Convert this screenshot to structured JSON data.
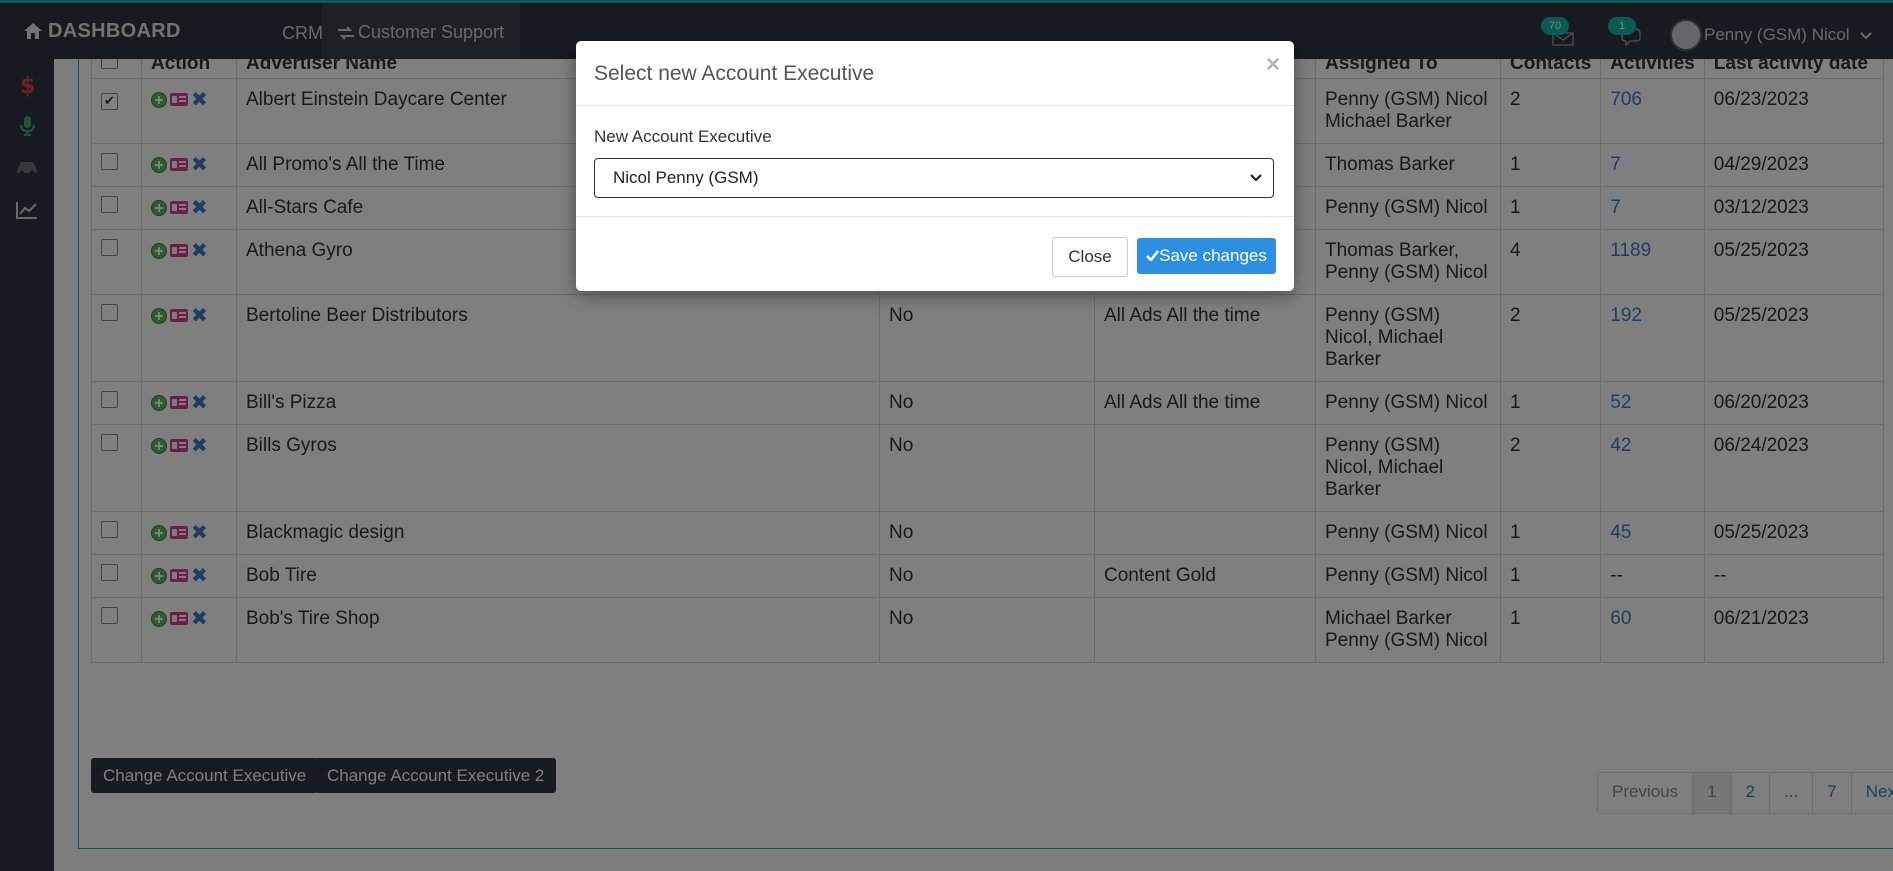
{
  "topbar": {
    "brand": "DASHBOARD",
    "nav_crm": "CRM",
    "nav_customer_support": "Customer Support",
    "notif_messages": "70",
    "notif_chat": "1",
    "user_name": "Penny (GSM) Nicol"
  },
  "sidebar": {
    "icons": [
      "dollar-icon",
      "microphone-icon",
      "car-icon",
      "line-chart-icon"
    ]
  },
  "table": {
    "headers": [
      "",
      "Action",
      "Advertiser Name",
      "",
      "",
      "Assigned To",
      "Contacts",
      "Activities",
      "Last activity date"
    ],
    "rows": [
      {
        "checked": true,
        "name": "Albert Einstein Daycare Center",
        "col4": "",
        "col5": "",
        "assigned": "Penny (GSM) Nicol Michael Barker",
        "contacts": "2",
        "activities": "706",
        "last": "06/23/2023"
      },
      {
        "checked": false,
        "name": "All Promo's All the Time",
        "col4": "",
        "col5": "",
        "assigned": "Thomas Barker",
        "contacts": "1",
        "activities": "7",
        "last": "04/29/2023"
      },
      {
        "checked": false,
        "name": "All-Stars Cafe",
        "col4": "",
        "col5": "",
        "assigned": "Penny (GSM) Nicol",
        "contacts": "1",
        "activities": "7",
        "last": "03/12/2023"
      },
      {
        "checked": false,
        "name": "Athena Gyro",
        "col4": "",
        "col5": "",
        "assigned": "Thomas Barker, Penny (GSM) Nicol",
        "contacts": "4",
        "activities": "1189",
        "last": "05/25/2023"
      },
      {
        "checked": false,
        "name": "Bertoline Beer Distributors",
        "col4": "No",
        "col5": "All Ads All the time",
        "assigned": "Penny (GSM) Nicol, Michael Barker",
        "contacts": "2",
        "activities": "192",
        "last": "05/25/2023"
      },
      {
        "checked": false,
        "name": "Bill's Pizza",
        "col4": "No",
        "col5": "All Ads All the time",
        "assigned": "Penny (GSM) Nicol",
        "contacts": "1",
        "activities": "52",
        "last": "06/20/2023"
      },
      {
        "checked": false,
        "name": "Bills Gyros",
        "col4": "No",
        "col5": "",
        "assigned": "Penny (GSM) Nicol, Michael Barker",
        "contacts": "2",
        "activities": "42",
        "last": "06/24/2023"
      },
      {
        "checked": false,
        "name": "Blackmagic design",
        "col4": "No",
        "col5": "",
        "assigned": "Penny (GSM) Nicol",
        "contacts": "1",
        "activities": "45",
        "last": "05/25/2023"
      },
      {
        "checked": false,
        "name": "Bob Tire",
        "col4": "No",
        "col5": "Content Gold",
        "assigned": "Penny (GSM) Nicol",
        "contacts": "1",
        "activities": "--",
        "last": "--"
      },
      {
        "checked": false,
        "name": "Bob's Tire Shop",
        "col4": "No",
        "col5": "",
        "assigned": "Michael Barker Penny (GSM) Nicol",
        "contacts": "1",
        "activities": "60",
        "last": "06/21/2023"
      }
    ]
  },
  "buttons": {
    "change_ae": "Change Account Executive",
    "change_ae2": "Change Account Executive 2"
  },
  "pagination": [
    "Previous",
    "1",
    "2",
    "...",
    "7",
    "Next"
  ],
  "modal": {
    "title": "Select new Account Executive",
    "close_x": "×",
    "field_label": "New Account Executive",
    "selected_value": "Nicol Penny (GSM)",
    "close_label": "Close",
    "save_label": "Save changes"
  }
}
